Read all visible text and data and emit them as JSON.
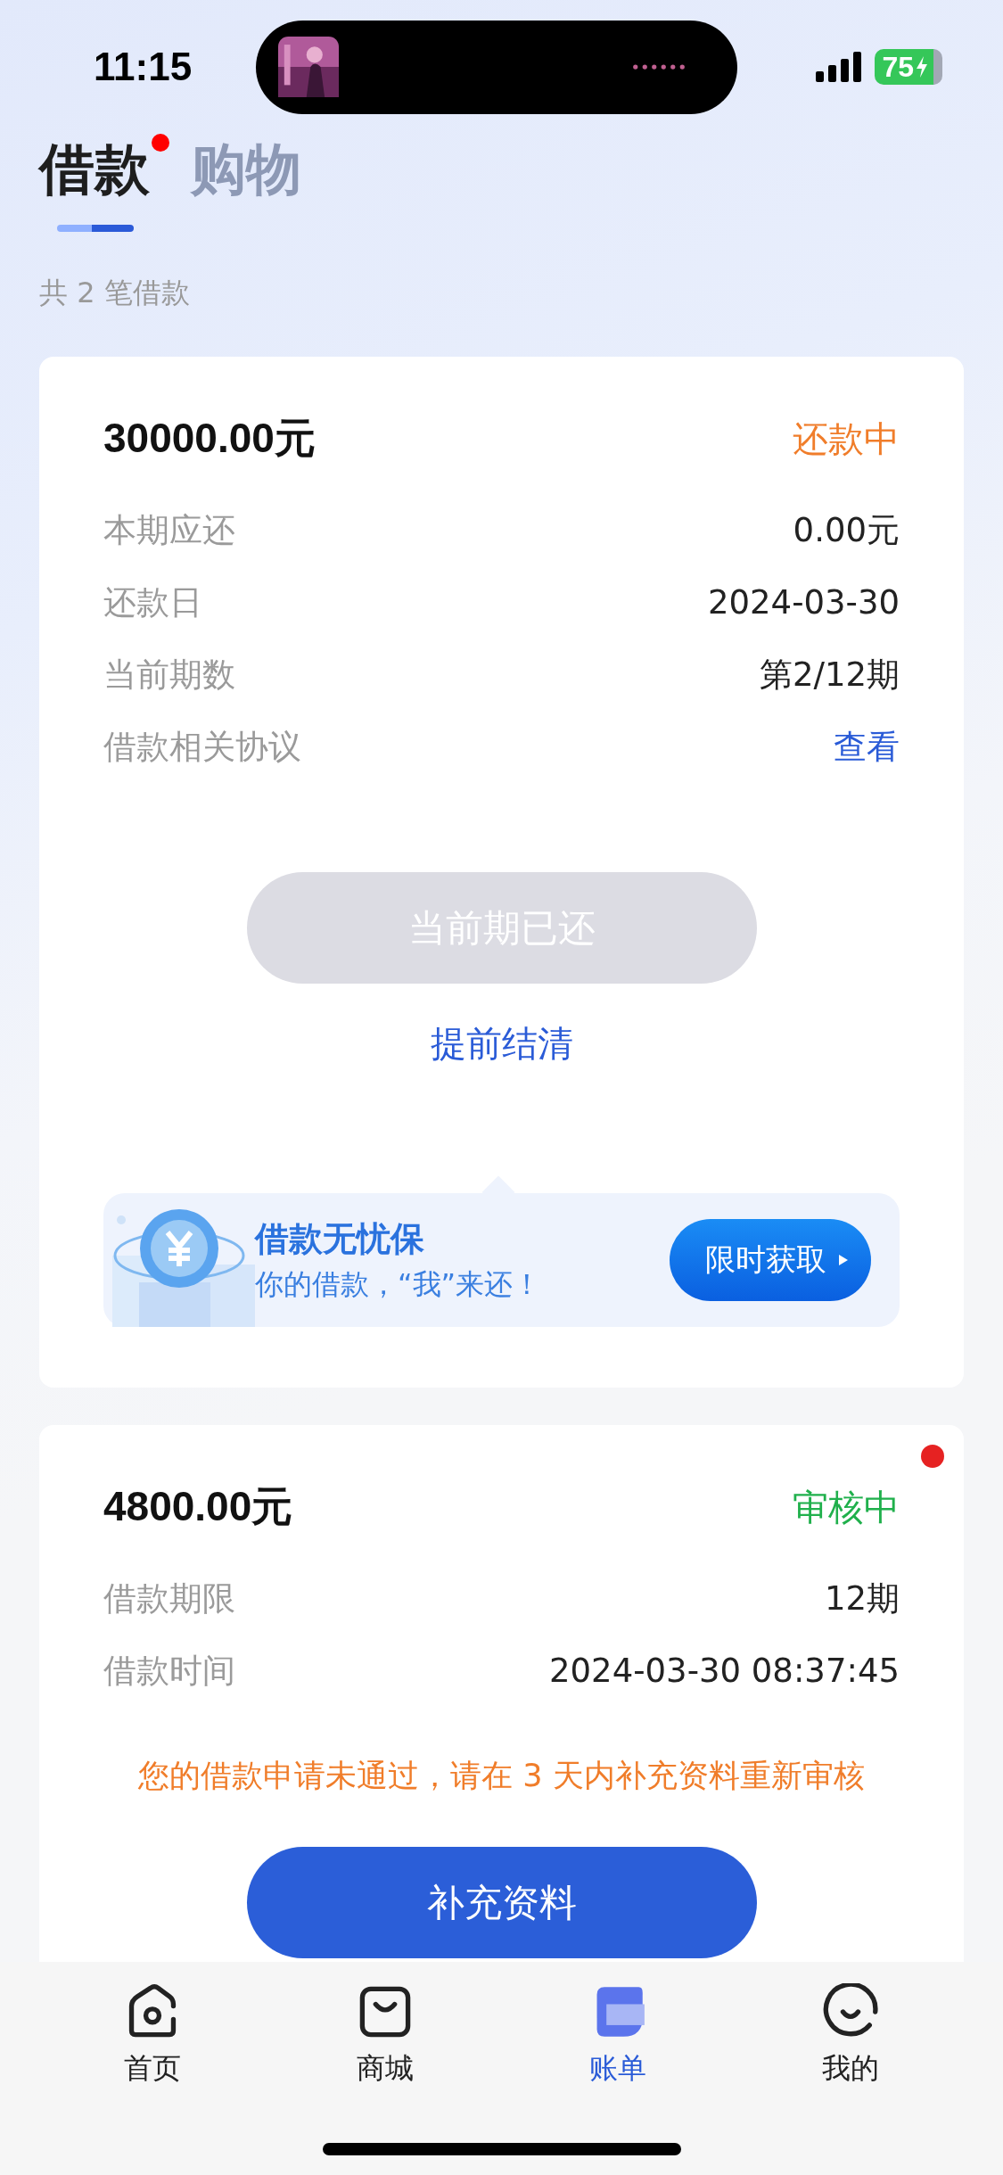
{
  "status_bar": {
    "time": "11:15",
    "battery": "75"
  },
  "tabs": [
    {
      "label": "借款",
      "selected": true,
      "dot": true
    },
    {
      "label": "购物",
      "selected": false,
      "dot": false
    }
  ],
  "summary": "共 2 笔借款",
  "loans": [
    {
      "amount": "30000.00元",
      "status": {
        "text": "还款中",
        "color": "#f07d2a"
      },
      "dot": false,
      "rows": [
        {
          "label": "本期应还",
          "value": "0.00元",
          "kind": "text"
        },
        {
          "label": "还款日",
          "value": "2024-03-30",
          "kind": "text"
        },
        {
          "label": "当前期数",
          "value": "第2/12期",
          "kind": "text"
        },
        {
          "label": "借款相关协议",
          "value": "查看",
          "kind": "link"
        }
      ],
      "button": {
        "label": "当前期已还",
        "disabled": true
      },
      "link": "提前结清",
      "promo": {
        "title": "借款无忧保",
        "subtitle": "你的借款，“我”来还！",
        "button": "限时获取"
      }
    },
    {
      "amount": "4800.00元",
      "status": {
        "text": "审核中",
        "color": "#20b04c"
      },
      "dot": true,
      "rows": [
        {
          "label": "借款期限",
          "value": "12期",
          "kind": "text"
        },
        {
          "label": "借款时间",
          "value": "2024-03-30 08:37:45",
          "kind": "text"
        }
      ],
      "notice": "您的借款申请未通过，请在 3 天内补充资料重新审核",
      "button": {
        "label": "补充资料",
        "disabled": false
      }
    }
  ],
  "nav": [
    {
      "label": "首页",
      "kind": "home",
      "selected": false
    },
    {
      "label": "商城",
      "kind": "shop",
      "selected": false
    },
    {
      "label": "账单",
      "kind": "bill",
      "selected": true
    },
    {
      "label": "我的",
      "kind": "profile",
      "selected": false
    }
  ]
}
